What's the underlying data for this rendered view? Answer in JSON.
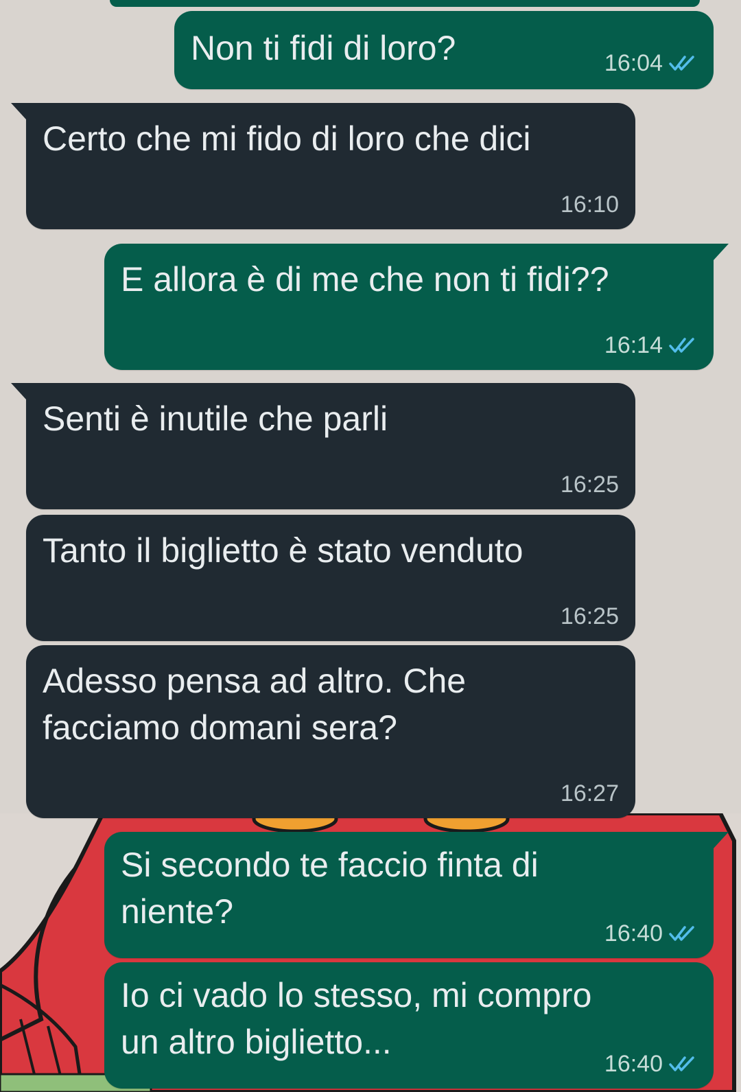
{
  "colors": {
    "background": "#d9d4cf",
    "outgoing_bubble": "#055d4b",
    "incoming_bubble": "#202a32",
    "text": "#e9edef",
    "read_ticks": "#53bdeb"
  },
  "messages": [
    {
      "direction": "outgoing",
      "text": "Non ti fidi di loro?",
      "time": "16:04",
      "status": "read"
    },
    {
      "direction": "incoming",
      "text": "Certo che mi fido di loro che dici",
      "time": "16:10"
    },
    {
      "direction": "outgoing",
      "text": "E allora è di me che non ti fidi??",
      "time": "16:14",
      "status": "read"
    },
    {
      "direction": "incoming",
      "text": "Senti è inutile che parli",
      "time": "16:25"
    },
    {
      "direction": "incoming",
      "text": "Tanto il biglietto è stato venduto",
      "time": "16:25"
    },
    {
      "direction": "incoming",
      "text": "Adesso pensa ad altro. Che\nfacciamo domani sera?",
      "time": "16:27"
    },
    {
      "direction": "outgoing",
      "text": "Si secondo te faccio finta di\nniente?",
      "time": "16:40",
      "status": "read"
    },
    {
      "direction": "outgoing",
      "text": "Io ci vado lo stesso, mi compro\nun altro biglietto...",
      "time": "16:40",
      "status": "read"
    }
  ],
  "icons": {
    "read_receipt": "double-check-icon"
  }
}
